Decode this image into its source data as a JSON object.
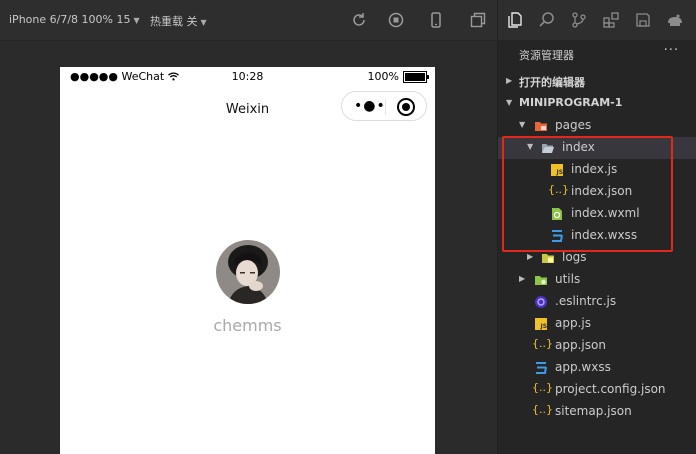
{
  "toolbar": {
    "device": "iPhone 6/7/8 100% 15",
    "hot_reload": "热重载 关",
    "icons": [
      "compile-icon",
      "preview-icon",
      "phone-icon",
      "window-icon"
    ]
  },
  "simulator": {
    "status_left": "●●●●● WeChat",
    "time": "10:28",
    "battery": "100%",
    "battery_level": 1.0,
    "nav_title": "Weixin",
    "capsule_dots": "•●•",
    "nickname": "chemms"
  },
  "sidebar_tabs": [
    "files-icon",
    "search-icon",
    "source-control-icon",
    "extensions-icon",
    "storage-icon",
    "debug-icon"
  ],
  "explorer": {
    "title": "资源管理器",
    "more": "···",
    "open_editors": "打开的编辑器",
    "project": "MINIPROGRAM-1",
    "tree": [
      {
        "label": "pages",
        "kind": "folder-pages"
      },
      {
        "label": "index",
        "kind": "folder"
      },
      {
        "label": "index.js",
        "kind": "js"
      },
      {
        "label": "index.json",
        "kind": "json"
      },
      {
        "label": "index.wxml",
        "kind": "wxml"
      },
      {
        "label": "index.wxss",
        "kind": "wxss"
      },
      {
        "label": "logs",
        "kind": "folder-logs"
      },
      {
        "label": "utils",
        "kind": "folder-utils"
      },
      {
        "label": ".eslintrc.js",
        "kind": "eslint"
      },
      {
        "label": "app.js",
        "kind": "js"
      },
      {
        "label": "app.json",
        "kind": "json"
      },
      {
        "label": "app.wxss",
        "kind": "wxss"
      },
      {
        "label": "project.config.json",
        "kind": "json"
      },
      {
        "label": "sitemap.json",
        "kind": "json"
      }
    ]
  },
  "colors": {
    "highlight": "#e0281d",
    "js": "#f0c22a",
    "json": "#f0c22a",
    "wxml": "#8cc34a",
    "wxss": "#3e9be9",
    "folder_pages": "#e8643c",
    "folder_utils": "#8cc34a",
    "folder_logs": "#c5c946"
  }
}
